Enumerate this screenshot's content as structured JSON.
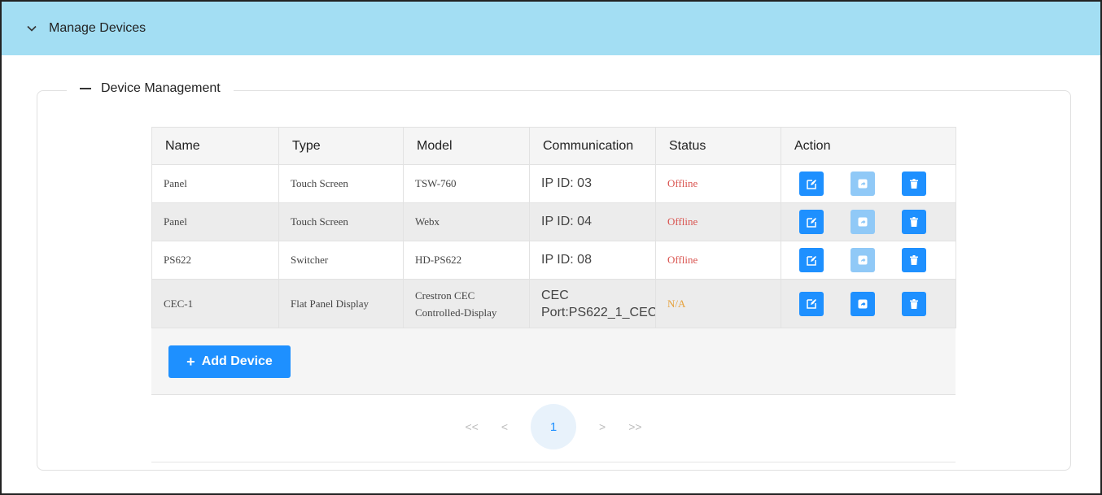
{
  "accordion": {
    "title": "Manage Devices"
  },
  "section": {
    "title": "Device Management"
  },
  "table": {
    "headers": [
      "Name",
      "Type",
      "Model",
      "Communication",
      "Status",
      "Action"
    ],
    "rows": [
      {
        "name": "Panel",
        "type": "Touch Screen",
        "model": "TSW-760",
        "communication": "IP ID: 03",
        "status": "Offline"
      },
      {
        "name": "Panel",
        "type": "Touch Screen",
        "model": "Webx",
        "communication": "IP ID: 04",
        "status": "Offline"
      },
      {
        "name": "PS622",
        "type": "Switcher",
        "model": "HD-PS622",
        "communication": "IP ID: 08",
        "status": "Offline"
      },
      {
        "name": "CEC-1",
        "type": "Flat Panel Display",
        "model_line1": "Crestron CEC",
        "model_line2": "Controlled-Display",
        "communication_line1": "CEC",
        "communication_line2": "Port:PS622_1_CEC",
        "status": "N/A"
      }
    ]
  },
  "add_button": {
    "label": "Add Device"
  },
  "pagination": {
    "first": "<<",
    "prev": "<",
    "current": "1",
    "next": ">",
    "last": ">>"
  },
  "colors": {
    "header_bg": "#a3def3",
    "primary": "#1e90ff",
    "offline": "#d9534f",
    "na": "#e6a23c"
  }
}
